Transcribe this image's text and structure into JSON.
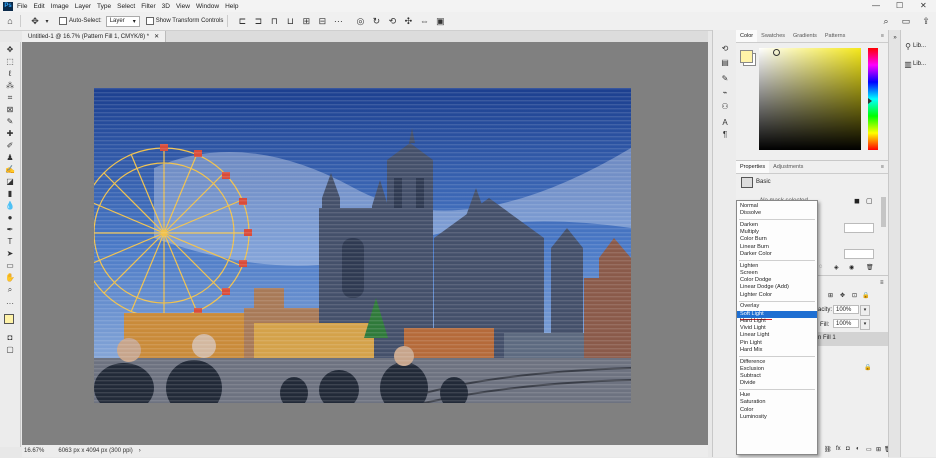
{
  "app": {
    "logo_text": "Ps"
  },
  "menu": [
    "File",
    "Edit",
    "Image",
    "Layer",
    "Type",
    "Select",
    "Filter",
    "3D",
    "View",
    "Window",
    "Help"
  ],
  "window_controls": {
    "minimize": "—",
    "restore": "☐",
    "close": "✕"
  },
  "options_bar": {
    "auto_select_label": "Auto-Select:",
    "auto_select_value": "Layer",
    "transform_label": "Show Transform Controls"
  },
  "document": {
    "tab_title": "Untitled-1 @ 16.7% (Pattern Fill 1, CMYK/8) *",
    "zoom": "16.67%",
    "size_info": "6063 px x 4094 px (300 ppi)"
  },
  "color_panel": {
    "tabs": [
      "Color",
      "Swatches",
      "Gradients",
      "Patterns"
    ],
    "fg_color": "#fff3a8",
    "bg_color": "#ffffff",
    "picker_hue": "#f5e81b"
  },
  "properties_panel": {
    "tabs": [
      "Properties",
      "Adjustments"
    ],
    "kind_label": "Basic",
    "selection_text": "No mask selected"
  },
  "layers_panel": {
    "opacity_label": "acity:",
    "opacity_value": "100%",
    "fill_label": "Fill:",
    "fill_value": "100%",
    "layer_name": "n Fill 1"
  },
  "libraries": {
    "item1": "Lib...",
    "item2": "Lib..."
  },
  "blend_modes": {
    "selected": "Soft Light",
    "groups": [
      [
        "Normal",
        "Dissolve"
      ],
      [
        "Darken",
        "Multiply",
        "Color Burn",
        "Linear Burn",
        "Darker Color"
      ],
      [
        "Lighten",
        "Screen",
        "Color Dodge",
        "Linear Dodge (Add)",
        "Lighter Color"
      ],
      [
        "Overlay",
        "Soft Light",
        "Hard Light",
        "Vivid Light",
        "Linear Light",
        "Pin Light",
        "Hard Mix"
      ],
      [
        "Difference",
        "Exclusion",
        "Subtract",
        "Divide"
      ],
      [
        "Hue",
        "Saturation",
        "Color",
        "Luminosity"
      ]
    ]
  },
  "accent": {
    "selection": "#1f6fd2",
    "underline": "#d62020"
  }
}
